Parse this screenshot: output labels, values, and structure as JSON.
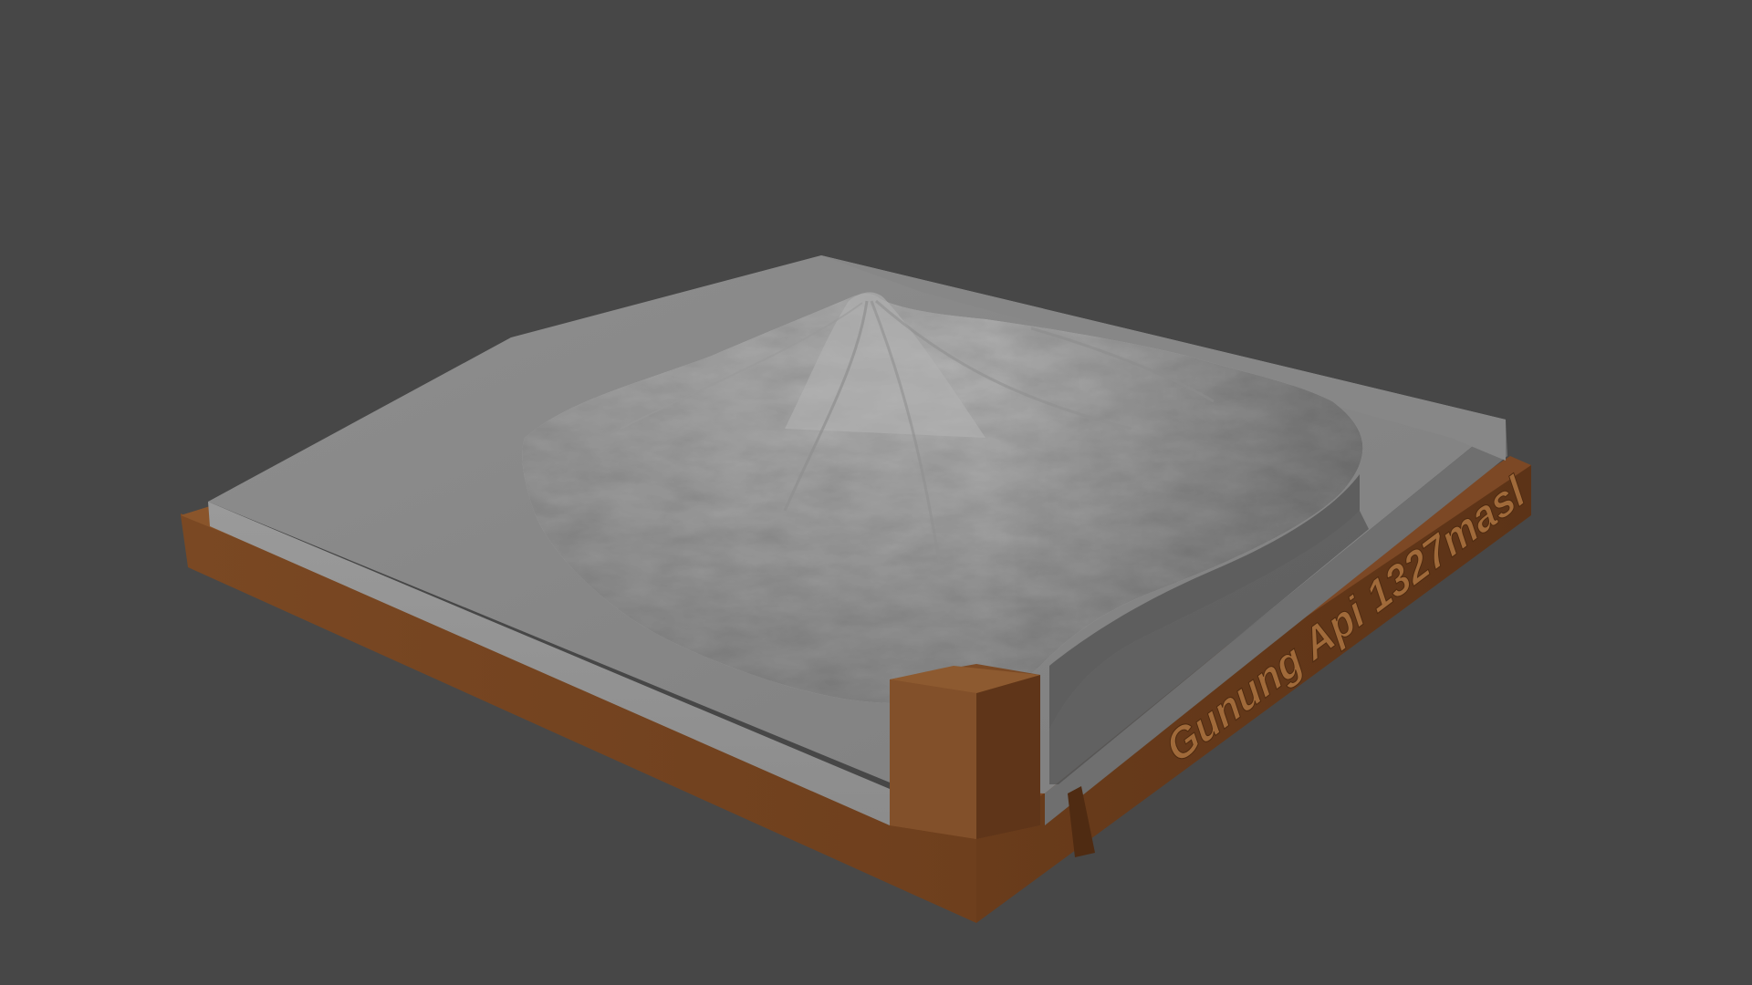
{
  "model": {
    "base_label": "Gunung Api 1327masl",
    "north_marker_label": "",
    "base_color": "#7a4a26",
    "base_shadow_color": "#5a3418",
    "terrain_color": "#9a9a9a",
    "terrain_highlight": "#b4b4b4",
    "terrain_shadow": "#6e6e6e"
  },
  "viewport": {
    "background_color": "#474747"
  }
}
